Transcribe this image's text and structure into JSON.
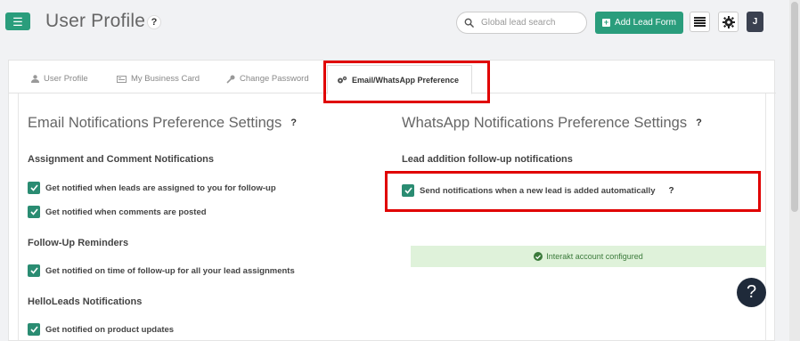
{
  "header": {
    "title": "User Profile",
    "title_help": "?",
    "search": {
      "placeholder": "Global lead search",
      "value": ""
    },
    "add_lead_label": "Add Lead Form",
    "avatar_initial": "J",
    "menu_icon": "hamburger-icon"
  },
  "tabs": [
    {
      "label": "User Profile",
      "icon": "user-icon",
      "active": false
    },
    {
      "label": "My Business Card",
      "icon": "id-card-icon",
      "active": false
    },
    {
      "label": "Change Password",
      "icon": "key-icon",
      "active": false
    },
    {
      "label": "Email/WhatsApp Preference",
      "icon": "gears-icon",
      "active": true
    }
  ],
  "email": {
    "title": "Email Notifications Preference Settings",
    "help": "?",
    "groups": [
      {
        "heading": "Assignment and Comment Notifications",
        "items": [
          {
            "label": "Get notified when leads are assigned to you for follow-up",
            "checked": true
          },
          {
            "label": "Get notified when comments are posted",
            "checked": true
          }
        ]
      },
      {
        "heading": "Follow-Up Reminders",
        "items": [
          {
            "label": "Get notified on time of follow-up for all your lead assignments",
            "checked": true
          }
        ]
      },
      {
        "heading": "HelloLeads Notifications",
        "items": [
          {
            "label": "Get notified on product updates",
            "checked": true
          }
        ]
      }
    ]
  },
  "whatsapp": {
    "title": "WhatsApp Notifications Preference Settings",
    "help": "?",
    "heading": "Lead addition follow-up notifications",
    "item": {
      "label": "Send notifications when a new lead is added automatically",
      "checked": true,
      "help": "?"
    },
    "status": "Interakt account configured"
  },
  "help_fab": "?",
  "colors": {
    "accent": "#2a9d7c",
    "highlight": "#e00000",
    "success_bg": "#dff2da",
    "success_text": "#3b7a3b"
  }
}
